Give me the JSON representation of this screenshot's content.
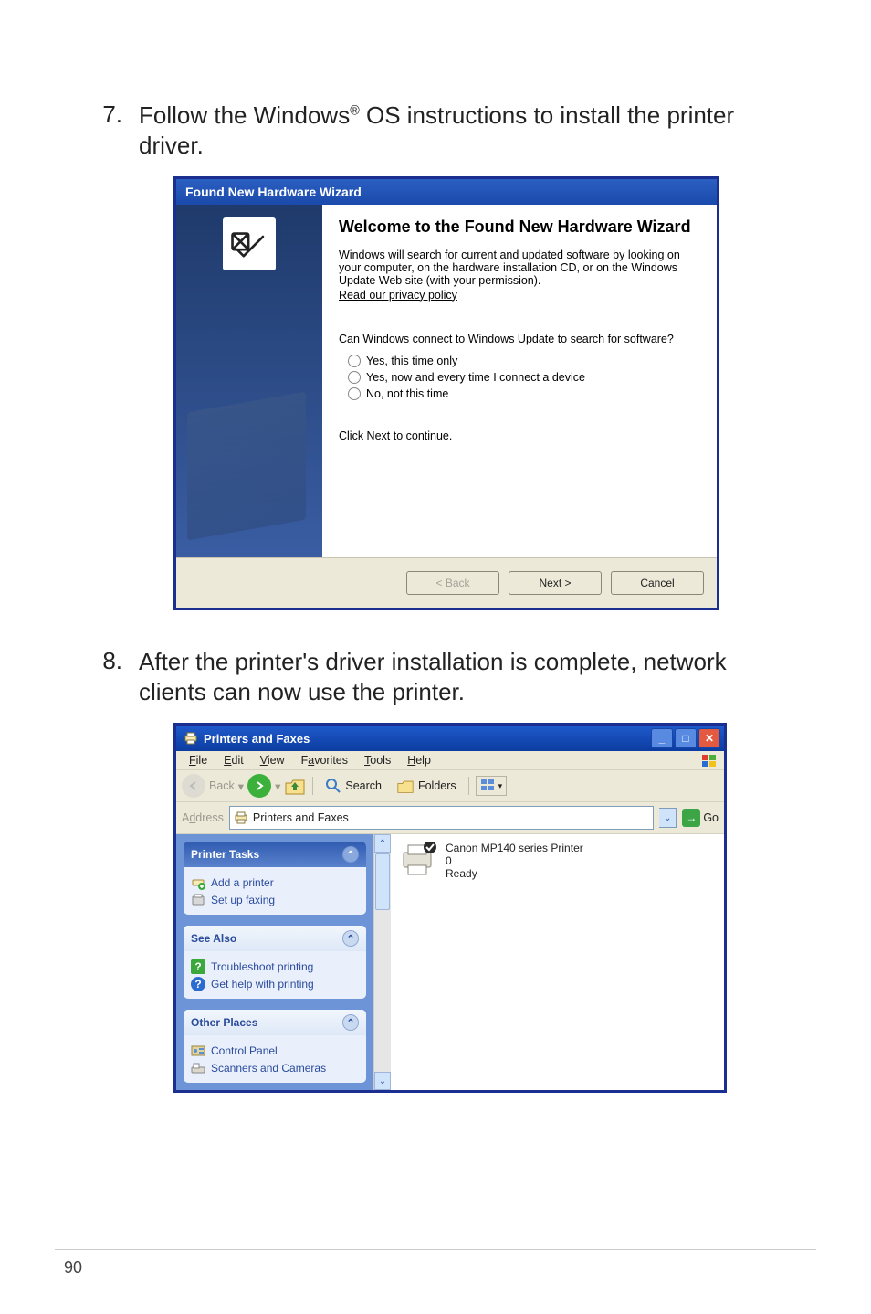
{
  "step1": {
    "num": "7.",
    "text_prefix": "Follow the Windows",
    "text_suffix": " OS instructions to install the printer driver."
  },
  "wizard": {
    "titlebar": "Found New Hardware Wizard",
    "heading": "Welcome to the Found New Hardware Wizard",
    "para": "Windows will search for current and updated software by looking on your computer, on the hardware installation CD, or on the Windows Update Web site (with your permission).",
    "link": "Read our privacy policy",
    "question": "Can Windows connect to Windows Update to search for software?",
    "opt1": "Yes, this time only",
    "opt2": "Yes, now and every time I connect a device",
    "opt3": "No, not this time",
    "continue": "Click Next to continue.",
    "btn_back": "< Back",
    "btn_next": "Next >",
    "btn_cancel": "Cancel"
  },
  "step2": {
    "num": "8.",
    "text": "After the printer's driver installation is complete, network clients can now use the printer."
  },
  "explorer": {
    "title": "Printers and Faxes",
    "menus": {
      "file": "File",
      "edit": "Edit",
      "view": "View",
      "favorites": "Favorites",
      "tools": "Tools",
      "help": "Help"
    },
    "toolbar": {
      "back": "Back",
      "search": "Search",
      "folders": "Folders"
    },
    "address_label": "Address",
    "address_value": "Printers and Faxes",
    "go": "Go",
    "side": {
      "box1": {
        "title": "Printer Tasks",
        "link1": "Add a printer",
        "link2": "Set up faxing"
      },
      "box2": {
        "title": "See Also",
        "link1": "Troubleshoot printing",
        "link2": "Get help with printing"
      },
      "box3": {
        "title": "Other Places",
        "link1": "Control Panel",
        "link2": "Scanners and Cameras"
      }
    },
    "printer": {
      "name": "Canon MP140 series Printer",
      "jobs": "0",
      "status": "Ready"
    }
  },
  "page_number": "90"
}
